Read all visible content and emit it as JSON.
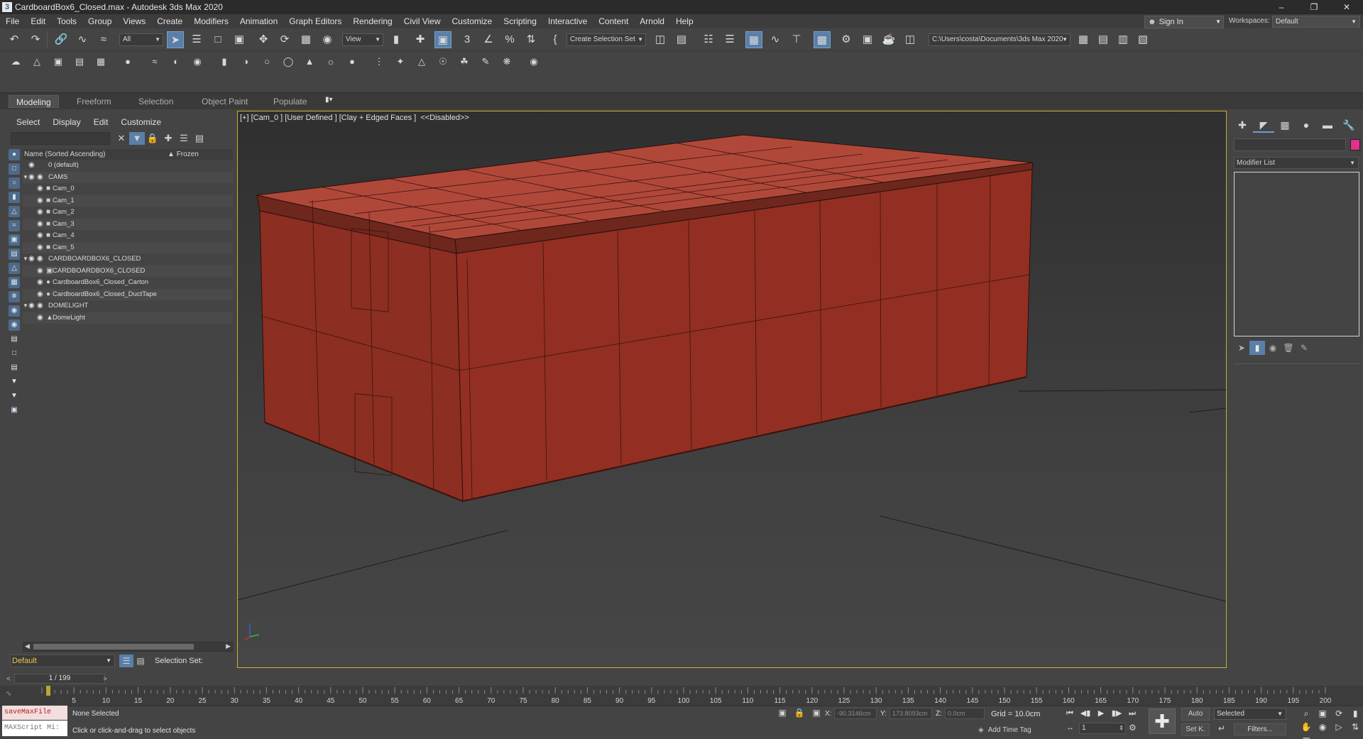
{
  "window": {
    "title": "CardboardBox6_Closed.max - Autodesk 3ds Max 2020",
    "app_icon": "3"
  },
  "menu": [
    "File",
    "Edit",
    "Tools",
    "Group",
    "Views",
    "Create",
    "Modifiers",
    "Animation",
    "Graph Editors",
    "Rendering",
    "Civil View",
    "Customize",
    "Scripting",
    "Interactive",
    "Content",
    "Arnold",
    "Help"
  ],
  "signin": {
    "label": "Sign In"
  },
  "workspaces": {
    "label": "Workspaces:",
    "value": "Default"
  },
  "toolbar": {
    "filter_value": "All",
    "refcoord_value": "View",
    "selection_set_value": "Create Selection Set",
    "project_path": "C:\\Users\\costa\\Documents\\3ds Max 2020"
  },
  "ribbon": {
    "tabs": [
      "Modeling",
      "Freeform",
      "Selection",
      "Object Paint",
      "Populate"
    ],
    "active_tab": "Modeling"
  },
  "explorer": {
    "menu": [
      "Select",
      "Display",
      "Edit",
      "Customize"
    ],
    "header_name": "Name (Sorted Ascending)",
    "header_frozen": "Frozen",
    "rows": [
      {
        "label": "0 (default)",
        "level": 0,
        "expander": "",
        "icon": "layer-icon"
      },
      {
        "label": "CAMS",
        "level": 0,
        "expander": "▼",
        "icon": "layer-icon"
      },
      {
        "label": "Cam_0",
        "level": 1,
        "expander": "",
        "icon": "camera-icon"
      },
      {
        "label": "Cam_1",
        "level": 1,
        "expander": "",
        "icon": "camera-icon"
      },
      {
        "label": "Cam_2",
        "level": 1,
        "expander": "",
        "icon": "camera-icon"
      },
      {
        "label": "Cam_3",
        "level": 1,
        "expander": "",
        "icon": "camera-icon"
      },
      {
        "label": "Cam_4",
        "level": 1,
        "expander": "",
        "icon": "camera-icon"
      },
      {
        "label": "Cam_5",
        "level": 1,
        "expander": "",
        "icon": "camera-icon"
      },
      {
        "label": "CARDBOARDBOX6_CLOSED",
        "level": 0,
        "expander": "▼",
        "icon": "layer-stack-icon"
      },
      {
        "label": "CARDBOARDBOX6_CLOSED",
        "level": 1,
        "expander": "",
        "icon": "group-icon"
      },
      {
        "label": "CardboardBox6_Closed_Carton",
        "level": 1,
        "expander": "",
        "icon": "sphere-icon"
      },
      {
        "label": "CardboardBox6_Closed_DuctTape",
        "level": 1,
        "expander": "",
        "icon": "sphere-icon"
      },
      {
        "label": "DOMELIGHT",
        "level": 0,
        "expander": "▼",
        "icon": "layer-icon"
      },
      {
        "label": "DomeLight",
        "level": 1,
        "expander": "",
        "icon": "light-icon"
      }
    ]
  },
  "layer": {
    "current": "Default",
    "selection_set_label": "Selection Set:"
  },
  "viewport": {
    "label": "[+] [Cam_0 ] [User Defined ] [Clay + Edged Faces ]  <<Disabled>>",
    "object_color": "#8a3020"
  },
  "command_panel": {
    "modifier_list": "Modifier List",
    "object_color": "#e0328c"
  },
  "timeline": {
    "frame_display": "1 / 199",
    "ticks": [
      "5",
      "10",
      "15",
      "20",
      "25",
      "30",
      "35",
      "40",
      "45",
      "50",
      "55",
      "60",
      "65",
      "70",
      "75",
      "80",
      "85",
      "90",
      "95",
      "100",
      "105",
      "110",
      "115",
      "120",
      "125",
      "130",
      "135",
      "140",
      "145",
      "150",
      "155",
      "160",
      "165",
      "170",
      "175",
      "180",
      "185",
      "190",
      "195",
      "200"
    ]
  },
  "status": {
    "maxscript_top": "saveMaxFile",
    "maxscript_bottom": "MAXScript Mi:",
    "selection": "None Selected",
    "prompt": "Click or click-and-drag to select objects",
    "x_label": "X:",
    "x_value": "-90.3146cm",
    "y_label": "Y:",
    "y_value": "173.8093cm",
    "z_label": "Z:",
    "z_value": "0.0cm",
    "grid": "Grid = 10.0cm",
    "add_time_tag": "Add Time Tag",
    "auto": "Auto",
    "set_key": "Set K.",
    "key_filter": "Selected",
    "filters": "Filters...",
    "current_frame": "1"
  }
}
